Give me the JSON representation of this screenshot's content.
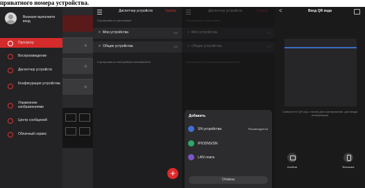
{
  "caption": "приватного номера устройства.",
  "side_menu": {
    "login": "Вначале выполните вход",
    "items": [
      {
        "label": "Просмотр",
        "active": true
      },
      {
        "label": "Воспроизведение",
        "active": false
      },
      {
        "label": "Диспетчер устройств",
        "active": false
      },
      {
        "label": "Конфигурация устройства",
        "active": false
      },
      {
        "label": "Управление изображениями",
        "active": false
      },
      {
        "label": "Центр сообщений",
        "active": false
      },
      {
        "label": "Облачный сервис",
        "active": false
      }
    ]
  },
  "device_manager": {
    "title": "Диспетчер устройств",
    "group_tab": "Группа",
    "section_sorted": "Сортировка по умолчанию",
    "rows": [
      {
        "arrow": ">",
        "name": "Мои устройства",
        "count": "0/0"
      },
      {
        "arrow": ">",
        "name": "Общие устройства",
        "count": "0/0"
      }
    ],
    "section_custom": "Сортировка по настройкам пользователя",
    "fab": "+"
  },
  "add_sheet": {
    "title": "Добавить",
    "options": [
      {
        "label": "SN устройства",
        "badge": "Рекомендуется",
        "color": "#3f6fd6"
      },
      {
        "label": "IP/DDNS/SN",
        "badge": "",
        "color": "#2ea86a"
      },
      {
        "label": "LAN поиск",
        "badge": "",
        "color": "#7d55c8"
      }
    ],
    "cancel": "Отмена"
  },
  "qr_scan": {
    "back": "<",
    "title": "Вход QR кода",
    "hint": "Совместите QR код с полем для сканирования, для ввода информации",
    "album": "Альбом",
    "flashlight": "Вспышка"
  },
  "colors": {
    "accent": "#d62b2b",
    "background": "#1e1e20",
    "scan_line": "#3d6fc4"
  }
}
